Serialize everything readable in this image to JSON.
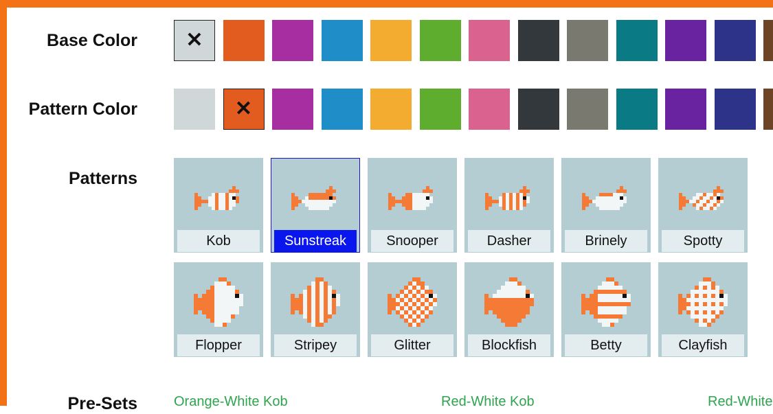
{
  "labels": {
    "base_color": "Base Color",
    "pattern_color": "Pattern Color",
    "patterns": "Patterns",
    "pre_sets": "Pre-Sets"
  },
  "colors": {
    "frame": "#f47216",
    "palette": [
      "#cfd7d9",
      "#e25c1f",
      "#a62ea1",
      "#1f8ec8",
      "#f3ab30",
      "#5fad2f",
      "#d9628f",
      "#33383c",
      "#7a796f",
      "#0a7b84",
      "#6a23a0",
      "#2d3389",
      "#6e4426"
    ],
    "selected_pattern_bg": "#0a16ee",
    "pattern_tile_bg": "#b3cdd2",
    "fish_body": "#f3f6f6",
    "fish_pattern": "#f47a35"
  },
  "swatches": {
    "base_selected_index": 0,
    "pattern_selected_index": 1,
    "selected_mark": "✕"
  },
  "patterns": [
    {
      "name": "Kob",
      "shape": "small",
      "style": "kob",
      "selected": false
    },
    {
      "name": "Sunstreak",
      "shape": "small",
      "style": "sunstreak",
      "selected": true
    },
    {
      "name": "Snooper",
      "shape": "small",
      "style": "snooper",
      "selected": false
    },
    {
      "name": "Dasher",
      "shape": "small",
      "style": "dasher",
      "selected": false
    },
    {
      "name": "Brinely",
      "shape": "small",
      "style": "brinely",
      "selected": false
    },
    {
      "name": "Spotty",
      "shape": "small",
      "style": "spotty",
      "selected": false
    },
    {
      "name": "Flopper",
      "shape": "large",
      "style": "flopper",
      "selected": false
    },
    {
      "name": "Stripey",
      "shape": "large",
      "style": "stripey",
      "selected": false
    },
    {
      "name": "Glitter",
      "shape": "large",
      "style": "glitter",
      "selected": false
    },
    {
      "name": "Blockfish",
      "shape": "large",
      "style": "blockfish",
      "selected": false
    },
    {
      "name": "Betty",
      "shape": "large",
      "style": "betty",
      "selected": false
    },
    {
      "name": "Clayfish",
      "shape": "large",
      "style": "clayfish",
      "selected": false
    }
  ],
  "presets": [
    "Orange-White Kob",
    "Red-White Kob",
    "Red-White"
  ]
}
